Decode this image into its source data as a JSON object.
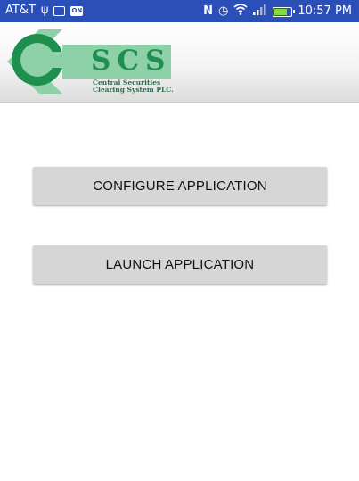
{
  "status_bar": {
    "carrier": "AT&T",
    "usb_icon": "usb-icon",
    "notification_icon": "window-icon",
    "on_badge": "ON",
    "nfc_icon": "nfc-icon",
    "alarm_icon": "alarm-icon",
    "wifi_icon": "wifi-icon",
    "signal_icon": "signal-icon",
    "battery_icon": "battery-charging-icon",
    "time": "10:57 PM",
    "color": "#2a4fb9"
  },
  "header": {
    "logo": {
      "acronym": "CSCS",
      "line1": "Central Securities",
      "line2": "Clearing System PLC.",
      "brand_color": "#1e8f4e",
      "accent_color": "#8ed1a8"
    }
  },
  "main": {
    "configure_button_label": "CONFIGURE APPLICATION",
    "launch_button_label": "LAUNCH APPLICATION"
  }
}
